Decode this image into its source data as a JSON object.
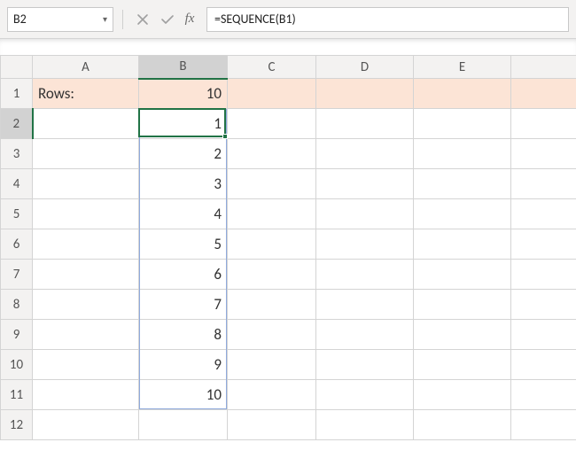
{
  "name_box": "B2",
  "formula_bar": "=SEQUENCE(B1)",
  "icons": {
    "dropdown": "chevron-down-icon",
    "cancel": "cancel-icon",
    "enter": "checkmark-icon",
    "fx": "fx"
  },
  "columns": [
    "A",
    "B",
    "C",
    "D",
    "E"
  ],
  "rows": [
    "1",
    "2",
    "3",
    "4",
    "5",
    "6",
    "7",
    "8",
    "9",
    "10",
    "11",
    "12"
  ],
  "cells": {
    "A1": "Rows:",
    "B1": "10",
    "B2": "1",
    "B3": "2",
    "B4": "3",
    "B5": "4",
    "B6": "5",
    "B7": "6",
    "B8": "7",
    "B9": "8",
    "B10": "9",
    "B11": "10"
  },
  "active_cell": "B2",
  "spill_range": "B2:B11"
}
